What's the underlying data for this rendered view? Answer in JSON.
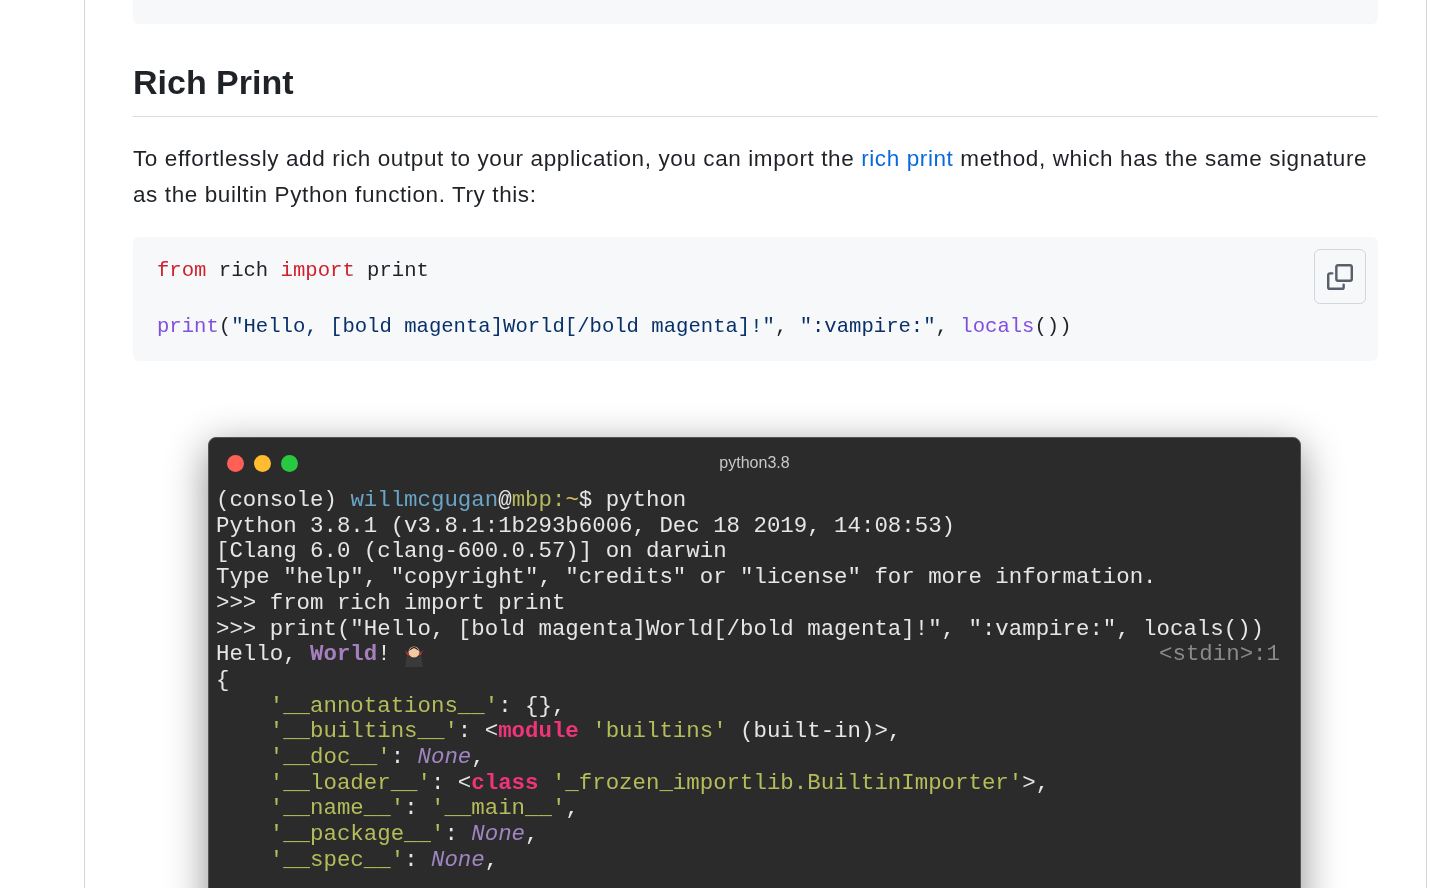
{
  "heading": "Rich Print",
  "paragraph": [
    {
      "kind": "text",
      "text": "To effortlessly add rich output to your application, you can import the "
    },
    {
      "kind": "link",
      "text": "rich print"
    },
    {
      "kind": "text",
      "text": " method, which has the same signature as the builtin Python function. Try this:"
    }
  ],
  "code_block": {
    "lines": [
      [
        {
          "kind": "keyword",
          "text": "from"
        },
        {
          "kind": "plain",
          "text": " rich "
        },
        {
          "kind": "keyword",
          "text": "import"
        },
        {
          "kind": "plain",
          "text": " print"
        }
      ],
      [
        {
          "kind": "builtin",
          "text": "print"
        },
        {
          "kind": "plain",
          "text": "("
        },
        {
          "kind": "string",
          "text": "\"Hello, [bold magenta]World[/bold magenta]!\""
        },
        {
          "kind": "plain",
          "text": ", "
        },
        {
          "kind": "string",
          "text": "\":vampire:\""
        },
        {
          "kind": "plain",
          "text": ", "
        },
        {
          "kind": "builtin",
          "text": "locals"
        },
        {
          "kind": "plain",
          "text": "())"
        }
      ]
    ]
  },
  "terminal": {
    "title": "python3.8",
    "lines": [
      {
        "segments": [
          {
            "kind": "plain",
            "text": "(console) "
          },
          {
            "kind": "user",
            "text": "willmcgugan"
          },
          {
            "kind": "plain",
            "text": "@"
          },
          {
            "kind": "host",
            "text": "mbp:"
          },
          {
            "kind": "path",
            "text": "~"
          },
          {
            "kind": "plain",
            "text": "$ python"
          }
        ]
      },
      {
        "segments": [
          {
            "kind": "plain",
            "text": "Python 3.8.1 (v3.8.1:1b293b6006, Dec 18 2019, 14:08:53)"
          }
        ]
      },
      {
        "segments": [
          {
            "kind": "plain",
            "text": "[Clang 6.0 (clang-600.0.57)] on darwin"
          }
        ]
      },
      {
        "segments": [
          {
            "kind": "plain",
            "text": "Type \"help\", \"copyright\", \"credits\" or \"license\" for more information."
          }
        ]
      },
      {
        "segments": [
          {
            "kind": "plain",
            "text": ">>> from rich import print"
          }
        ]
      },
      {
        "segments": [
          {
            "kind": "plain",
            "text": ">>> print(\"Hello, [bold magenta]World[/bold magenta]!\", \":vampire:\", locals())"
          }
        ]
      },
      {
        "segments": [
          {
            "kind": "plain",
            "text": "Hello, "
          },
          {
            "kind": "emphasis",
            "text": "World"
          },
          {
            "kind": "plain",
            "text": "!"
          }
        ],
        "emoji": true,
        "right": "<stdin>:1"
      },
      {
        "segments": [
          {
            "kind": "plain",
            "text": "{"
          }
        ]
      },
      {
        "segments": [
          {
            "kind": "string",
            "text": "    '__annotations__'"
          },
          {
            "kind": "plain",
            "text": ": {},"
          }
        ]
      },
      {
        "segments": [
          {
            "kind": "string",
            "text": "    '__builtins__'"
          },
          {
            "kind": "plain",
            "text": ": <"
          },
          {
            "kind": "keyword",
            "text": "module"
          },
          {
            "kind": "string",
            "text": " 'builtins'"
          },
          {
            "kind": "plain",
            "text": " (built-in)>,"
          }
        ]
      },
      {
        "segments": [
          {
            "kind": "string",
            "text": "    '__doc__'"
          },
          {
            "kind": "plain",
            "text": ": "
          },
          {
            "kind": "none",
            "text": "None"
          },
          {
            "kind": "plain",
            "text": ","
          }
        ]
      },
      {
        "segments": [
          {
            "kind": "string",
            "text": "    '__loader__'"
          },
          {
            "kind": "plain",
            "text": ": <"
          },
          {
            "kind": "keyword",
            "text": "class"
          },
          {
            "kind": "string",
            "text": " '_frozen_importlib.BuiltinImporter'"
          },
          {
            "kind": "plain",
            "text": ">,"
          }
        ]
      },
      {
        "segments": [
          {
            "kind": "string",
            "text": "    '__name__'"
          },
          {
            "kind": "plain",
            "text": ": "
          },
          {
            "kind": "string",
            "text": "'__main__'"
          },
          {
            "kind": "plain",
            "text": ","
          }
        ]
      },
      {
        "segments": [
          {
            "kind": "string",
            "text": "    '__package__'"
          },
          {
            "kind": "plain",
            "text": ": "
          },
          {
            "kind": "none",
            "text": "None"
          },
          {
            "kind": "plain",
            "text": ","
          }
        ]
      },
      {
        "segments": [
          {
            "kind": "string",
            "text": "    '__spec__'"
          },
          {
            "kind": "plain",
            "text": ": "
          },
          {
            "kind": "none",
            "text": "None"
          },
          {
            "kind": "plain",
            "text": ","
          }
        ]
      }
    ]
  }
}
